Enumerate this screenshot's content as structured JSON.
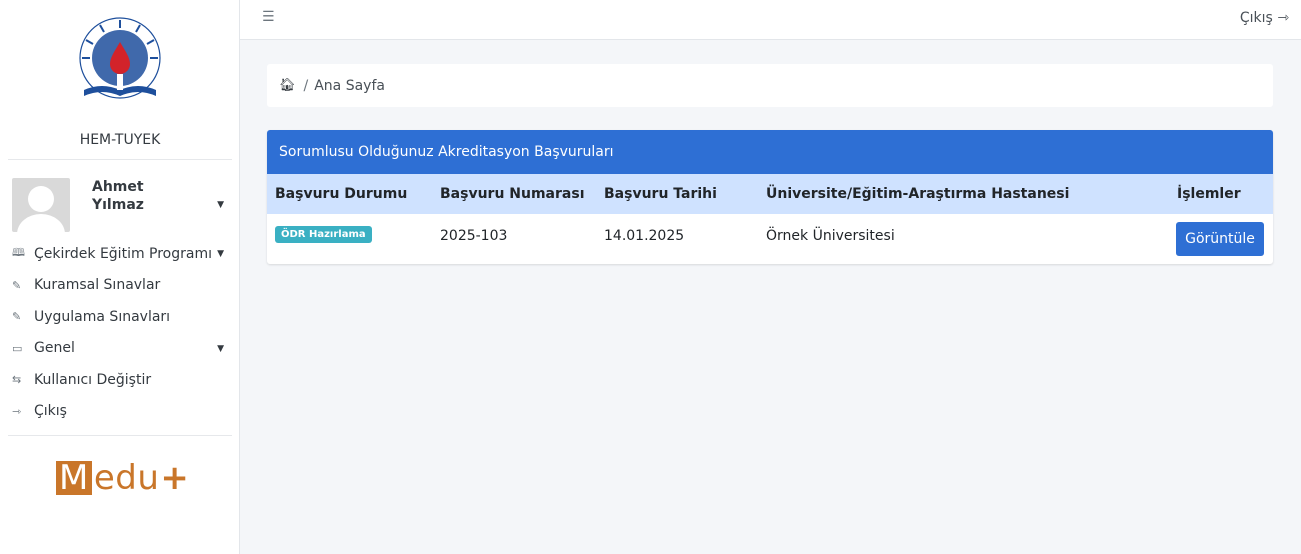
{
  "sidebar": {
    "org_name": "HEM-TUYEK",
    "user": {
      "first_name": "Ahmet",
      "last_name": "Yılmaz"
    },
    "menu": [
      {
        "label": "Çekirdek Eğitim Programı",
        "icon": "book-icon",
        "has_submenu": true
      },
      {
        "label": "Kuramsal Sınavlar",
        "icon": "edit-icon",
        "has_submenu": false
      },
      {
        "label": "Uygulama Sınavları",
        "icon": "edit-icon",
        "has_submenu": false
      },
      {
        "label": "Genel",
        "icon": "folder-icon",
        "has_submenu": true
      },
      {
        "label": "Kullanıcı Değiştir",
        "icon": "switch-icon",
        "has_submenu": false
      },
      {
        "label": "Çıkış",
        "icon": "logout-icon",
        "has_submenu": false
      }
    ],
    "brand": {
      "m": "M",
      "rest": "edu",
      "plus": "+"
    }
  },
  "topbar": {
    "logout_label": "Çıkış"
  },
  "breadcrumb": {
    "current": "Ana Sayfa"
  },
  "card": {
    "title": "Sorumlusu Olduğunuz Akreditasyon Başvuruları",
    "columns": [
      "Başvuru Durumu",
      "Başvuru Numarası",
      "Başvuru Tarihi",
      "Üniversite/Eğitim-Araştırma Hastanesi",
      "İşlemler"
    ],
    "rows": [
      {
        "status": "ÖDR Hazırlama",
        "number": "2025-103",
        "date": "14.01.2025",
        "institution": "Örnek Üniversitesi",
        "action": "Görüntüle"
      }
    ]
  },
  "colors": {
    "primary": "#2e6fd4",
    "table_header": "#cfe2ff",
    "badge": "#3ab0c3",
    "brand": "#c9762a"
  }
}
